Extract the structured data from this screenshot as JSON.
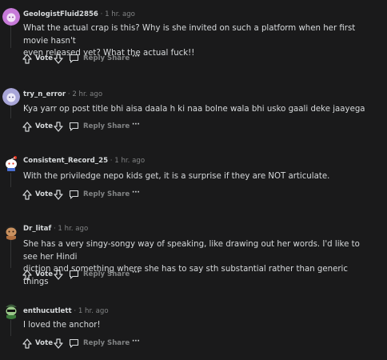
{
  "actions": {
    "vote": "Vote",
    "reply": "Reply",
    "share": "Share",
    "more": "···"
  },
  "comments": [
    {
      "username": "GeologistFluid2856",
      "time": "1 hr. ago",
      "avatar": "purple-snoo-avatar",
      "lines": [
        "What the actual crap is this? Why is she invited on such a platform when her first movie hasn't",
        "even released yet? What the actual fuck!!"
      ]
    },
    {
      "username": "try_n_error",
      "time": "2 hr. ago",
      "avatar": "lavender-snoo-avatar",
      "lines": [
        "Kya yarr op post title bhi aisa daala h ki naa bolne wala bhi usko gaali deke jaayega"
      ]
    },
    {
      "username": "Consistent_Record_25",
      "time": "1 hr. ago",
      "avatar": "snoo-avatar",
      "lines": [
        "With the priviledge nepo kids get, it is a surprise if they are NOT articulate."
      ]
    },
    {
      "username": "Dr_litaf",
      "time": "1 hr. ago",
      "avatar": "snoo-avatar",
      "lines": [
        "She has a very singy-songy way of speaking, like drawing out her words. I'd like to see her Hindi",
        "diction and something where she has to say sth substantial rather than generic things"
      ]
    },
    {
      "username": "enthucutlett",
      "time": "1 hr. ago",
      "avatar": "snoo-avatar",
      "lines": [
        "I loved the anchor!"
      ]
    }
  ]
}
